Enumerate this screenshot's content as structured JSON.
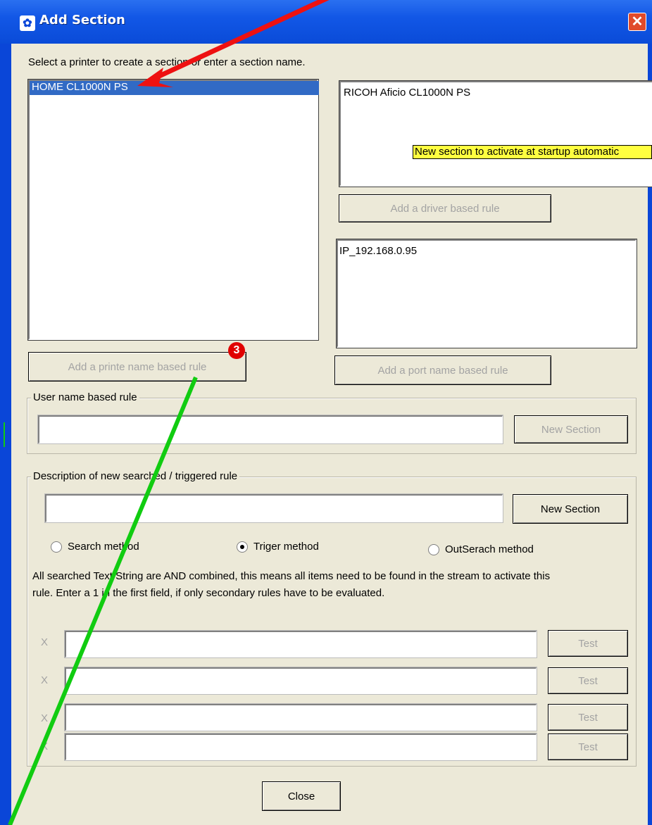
{
  "window": {
    "title": "Add Section",
    "app_icon": "app-icon",
    "close_glyph": "✕"
  },
  "instruction": "Select a printer to create a section or enter a section name.",
  "printer_list": {
    "items": [
      "HOME CL1000N PS"
    ],
    "selected": "HOME CL1000N PS"
  },
  "driver_box": {
    "value": "RICOH Aficio CL1000N PS",
    "tooltip": "New section to activate at startup automatic"
  },
  "buttons": {
    "driver_rule": "Add a driver based rule",
    "printer_rule": "Add a printe name based rule",
    "port_rule": "Add a port name based rule",
    "user_new_section": "New Section",
    "desc_new_section": "New Section",
    "close": "Close",
    "test": "Test"
  },
  "port_box": {
    "value": "IP_192.168.0.95"
  },
  "user_group": {
    "legend": "User name based rule",
    "input_value": ""
  },
  "desc_group": {
    "legend": "Description of new searched / triggered rule",
    "input_value": "",
    "radios": [
      {
        "label": "Search method",
        "checked": false
      },
      {
        "label": "Triger method",
        "checked": true
      },
      {
        "label": "OutSerach method",
        "checked": false
      }
    ],
    "info_text_line1": "All searched Text/String are AND combined, this means all items need to be found in the stream to activate this",
    "info_text_line2": "rule. Enter a 1 in the first field, if only secondary rules have to be evaluated.",
    "rows": [
      {
        "label": "X",
        "value": ""
      },
      {
        "label": "X",
        "value": ""
      },
      {
        "label": "X",
        "value": ""
      },
      {
        "label": "X",
        "value": ""
      }
    ]
  },
  "annotation": {
    "badge": "3",
    "colors": {
      "red_arrow": "#ee1111",
      "green_arrow": "#11cc11"
    }
  },
  "colors": {
    "titlebar": "#0a46d8",
    "dialog_bg": "#ece9d8",
    "selection": "#316ac5",
    "tooltip": "#ffff40"
  }
}
